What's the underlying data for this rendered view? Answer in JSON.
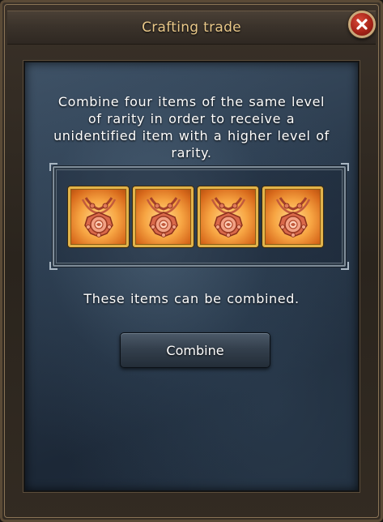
{
  "window": {
    "title": "Crafting trade",
    "close_icon": "close-icon"
  },
  "main": {
    "description": "Combine four items of the same level of rarity in order to receive a unidentified item with a higher level of rarity.",
    "slots": [
      {
        "item_icon": "necklace-icon"
      },
      {
        "item_icon": "necklace-icon"
      },
      {
        "item_icon": "necklace-icon"
      },
      {
        "item_icon": "necklace-icon"
      }
    ],
    "status_text": "These items can be combined.",
    "combine_label": "Combine"
  },
  "colors": {
    "title_text": "#e9c889",
    "slot_border": "#e2b34a",
    "close_button": "#a82418"
  }
}
